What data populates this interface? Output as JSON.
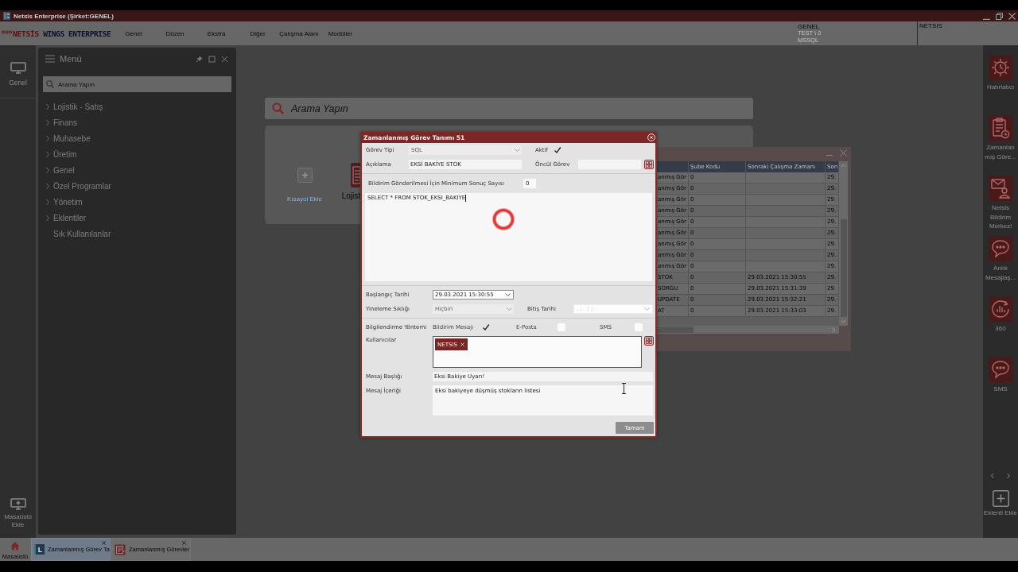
{
  "window": {
    "title": "Netsis Enterprise (Şirket:GENEL)"
  },
  "menu_bar": {
    "logo": {
      "brand": "NETSİS",
      "product": "WINGS ENTERPRISE"
    },
    "items": [
      "Genel",
      "Düzen",
      "Ekstra",
      "Diğer",
      "Çalışma Alanı",
      "Modüller"
    ],
    "company": {
      "name": "GENEL",
      "database": "TEST \\ 0",
      "server": "MSSQL"
    },
    "user": "NETSIS"
  },
  "left_rail": {
    "items": [
      {
        "label": "Genel"
      }
    ],
    "add_button": "Masaüstü Ekle"
  },
  "menu_panel": {
    "title": "Menü",
    "search": {
      "placeholder": "Arama Yapın"
    },
    "items": [
      {
        "label": "Lojistik - Satış",
        "kind": "group",
        "expanded": false
      },
      {
        "label": "Finans",
        "kind": "group",
        "expanded": false
      },
      {
        "label": "Muhasebe",
        "kind": "group",
        "expanded": false
      },
      {
        "label": "Üretim",
        "kind": "group",
        "expanded": false
      },
      {
        "label": "Genel",
        "kind": "group",
        "expanded": false
      },
      {
        "label": "Özel Programlar",
        "kind": "group",
        "expanded": false
      },
      {
        "label": "Yönetim",
        "kind": "group",
        "expanded": false
      },
      {
        "label": "Eklentiler",
        "kind": "group",
        "expanded": false
      },
      {
        "label": "Sık Kullanılanlar",
        "kind": "link"
      }
    ]
  },
  "desktop": {
    "search": {
      "placeholder": "Arama Yapın"
    },
    "shortcuts": [
      {
        "label": "Kısayol Ekle",
        "kind": "add"
      },
      {
        "label": "Lojist",
        "kind": "module"
      }
    ]
  },
  "background_window": {
    "columns": {
      "sube_kodu": "Şube Kodu",
      "sonraki_calisma_zamani": "Sonraki Çalışma Zamanı",
      "son": "Son"
    },
    "rows": [
      {
        "column_1": "anmış Gör",
        "sube_kodu": "0",
        "son": "29."
      },
      {
        "column_1": "anmış Gör",
        "sube_kodu": "0",
        "son": "29."
      },
      {
        "column_1": "anmış Gör",
        "sube_kodu": "0",
        "son": "29."
      },
      {
        "column_1": "anmış Gör",
        "sube_kodu": "0",
        "son": "29."
      },
      {
        "column_1": "anmış Gör",
        "sube_kodu": "0",
        "son": "29."
      },
      {
        "column_1": "anmış Gör",
        "sube_kodu": "0",
        "son": "29."
      },
      {
        "column_1": "anmış Gör",
        "sube_kodu": "0",
        "son": "29."
      },
      {
        "column_1": "anmış Gör",
        "sube_kodu": "0",
        "son": "29."
      },
      {
        "column_1": "anmış Gör",
        "sube_kodu": "0",
        "son": "29."
      },
      {
        "column_1": "STOK",
        "sube_kodu": "0",
        "sonraki_calisma_zamani": "29.03.2021 15:30:55",
        "son": "29."
      },
      {
        "column_1": "SORGU",
        "sube_kodu": "0",
        "sonraki_calisma_zamani": "29.03.2021 15:31:39",
        "son": "29."
      },
      {
        "column_1": "UPDATE",
        "sube_kodu": "0",
        "sonraki_calisma_zamani": "29.03.2021 15:32:21",
        "son": "29."
      },
      {
        "column_1": "AT",
        "sube_kodu": "0",
        "sonraki_calisma_zamani": "29.03.2021 15:33:03",
        "son": "29."
      }
    ]
  },
  "dialog": {
    "title": "Zamanlanmış Görev Tanımı 51",
    "gorev_tipi": {
      "label": "Görev Tipi",
      "value": "SQL"
    },
    "aktif": {
      "label": "Aktif",
      "checked": true
    },
    "aciklama": {
      "label": "Açıklama",
      "value": "EKSİ BAKİYE STOK"
    },
    "oncul_gorev": {
      "label": "Öncül Görev"
    },
    "min_sonuc": {
      "label": "Bildirim Gönderilmesi İçin Minimum Sonuç Sayısı",
      "value": "0"
    },
    "sql": {
      "value": "SELECT * FROM STOK_EKSI_BAKIYE"
    },
    "baslangic_tarihi": {
      "label": "Başlangıç Tarihi",
      "value": "29.03.2021 15:30:55"
    },
    "yineleme_sikligi": {
      "label": "Yineleme Sıklığı",
      "value": "Hiçbiri"
    },
    "bitis_tarihi": {
      "label": "Bitiş Tarihi",
      "placeholder": ". .   : :"
    },
    "bilgilendirme": {
      "label": "Bilgilendirme Yöntemi",
      "options": [
        {
          "label": "Bildirim Mesajı",
          "checked": true
        },
        {
          "label": "E-Posta",
          "checked": false
        },
        {
          "label": "SMS",
          "checked": false
        }
      ]
    },
    "kullanicilar": {
      "label": "Kullanıcılar",
      "tags": [
        "NETSIS"
      ]
    },
    "mesaj_basligi": {
      "label": "Mesaj Başlığı",
      "value": "Eksi Bakiye Uyarı!"
    },
    "mesaj_icerigi": {
      "label": "Mesaj İçeriği",
      "value": "Eksi bakiyeye düşmüş stokların listesi"
    },
    "buttons": [
      "Tamam"
    ]
  },
  "side_panel": {
    "items": [
      {
        "label": "Hatırlatıcı",
        "kind": "reminder"
      },
      {
        "label": "Zamanlanmış Göre...",
        "kind": "scheduled"
      },
      {
        "label": "Netsis Bildirim Merkezi",
        "kind": "notifications"
      },
      {
        "label": "Anlık Mesajlaş...",
        "kind": "chat"
      },
      {
        "label": "360",
        "kind": "analytics"
      },
      {
        "label": "SMS",
        "kind": "sms"
      }
    ],
    "add_button": "Eklenti Ekle"
  },
  "taskbar": {
    "home": "Masaüstü",
    "tabs": [
      {
        "label": "Zamanlanmış Görev Ta",
        "kind": "app",
        "badge": "L",
        "selected": true
      },
      {
        "label": "Zamanlanmış Görevler",
        "kind": "form",
        "selected": false
      }
    ]
  }
}
